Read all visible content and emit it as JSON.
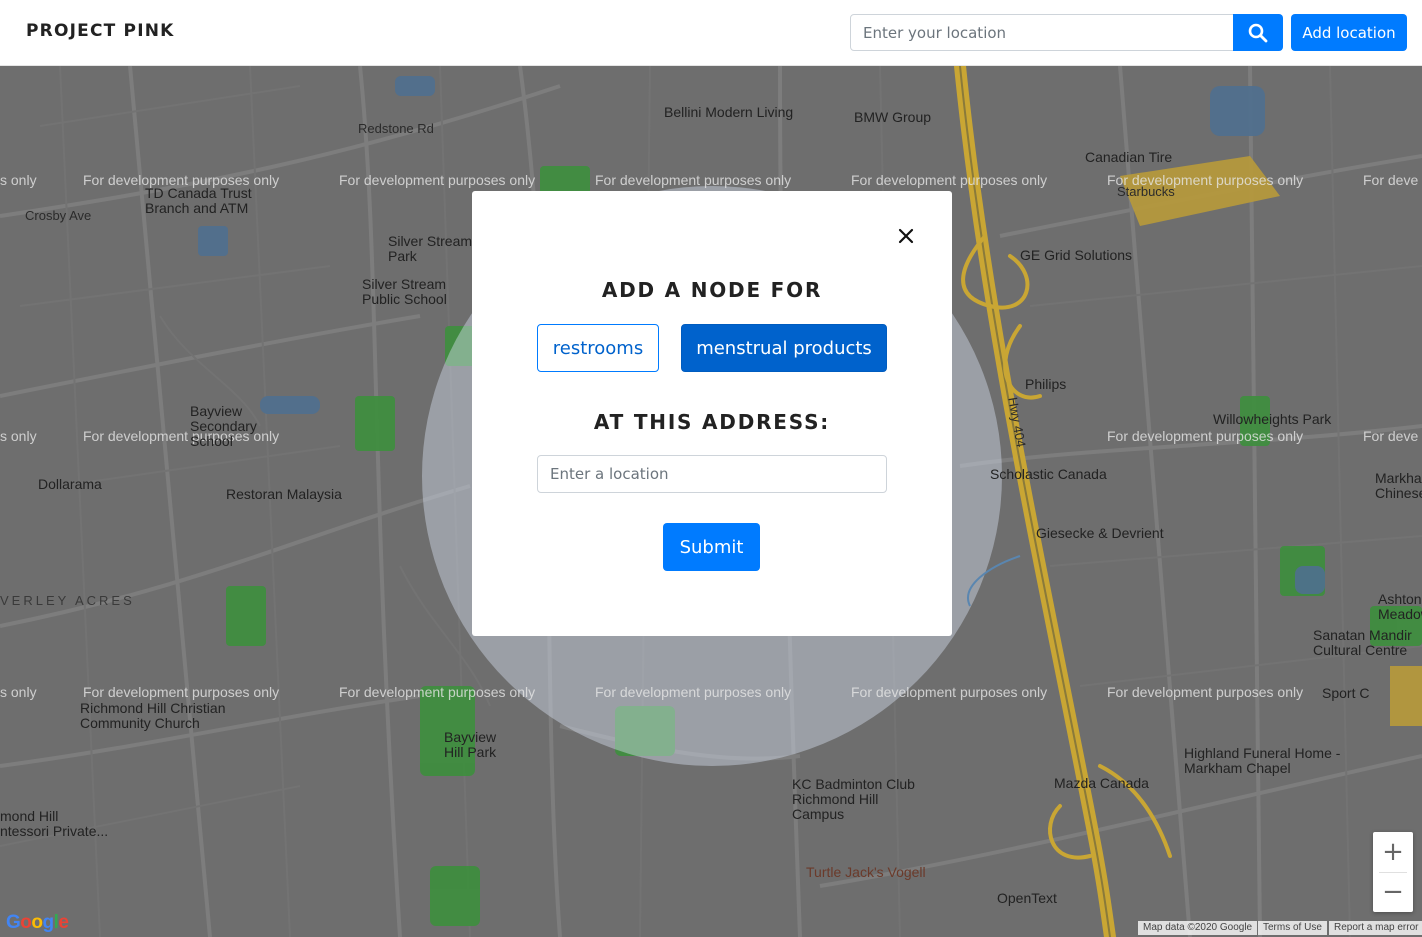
{
  "navbar": {
    "brand": "PROJECT PINK",
    "search_placeholder": "Enter your location",
    "add_location_label": "Add location"
  },
  "map": {
    "watermark": "For development purposes only",
    "watermark_partial_left": "s only",
    "watermark_partial_right": "For deve",
    "labels": [
      "Redstone Rd",
      "Bellini Modern Living",
      "BMW Group",
      "Canadian Tire",
      "Starbucks",
      "TD Canada Trust Branch and ATM",
      "Crosby Ave",
      "Silver Stream Park",
      "Silver Stream Public School",
      "GE Grid Solutions",
      "Philips",
      "Willowheights Park",
      "Bayview Secondary School",
      "Dollarama",
      "Restoran Malaysia",
      "Scholastic Canada",
      "Giesecke & Devrient",
      "Markham Chinese Baptist Church",
      "Ashton Meadows Park",
      "Sanatan Mandir Cultural Centre",
      "Richmond Hill Christian Community Church",
      "Bayview Hill Park",
      "Highland Funeral Home - Markham Chapel",
      "KC Badminton Club Richmond Hill Campus",
      "Mazda Canada",
      "Turtle Jack's Vogell",
      "OpenText",
      "VERLEY ACRES",
      "mond Hill ntessori Private...",
      "Hwy 404",
      "Sport C"
    ],
    "google_logo": "Google",
    "attribution": [
      "Map data ©2020 Google",
      "Terms of Use",
      "Report a map error"
    ],
    "zoom_in": "+",
    "zoom_out": "−"
  },
  "modal": {
    "heading": "ADD A NODE FOR",
    "option_restrooms": "restrooms",
    "option_products": "menstrual products",
    "selected_option": "menstrual products",
    "address_heading": "AT THIS ADDRESS:",
    "address_placeholder": "Enter a location",
    "submit_label": "Submit",
    "close_symbol": "×"
  },
  "colors": {
    "primary": "#007bff",
    "primary_active": "#0062cc",
    "map_background": "#6e6e6e",
    "park_green": "#3d8f3d",
    "highway_yellow": "#c9a634"
  }
}
